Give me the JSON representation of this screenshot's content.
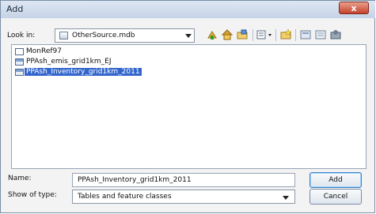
{
  "window": {
    "title": "Add",
    "close_glyph": "x"
  },
  "look_in": {
    "label": "Look in:",
    "value": "OtherSource.mdb",
    "icon": "database-icon"
  },
  "toolbar": [
    {
      "name": "go-up-icon"
    },
    {
      "name": "home-icon"
    },
    {
      "name": "connect-folder-icon"
    },
    {
      "name": "view-menu-icon"
    },
    {
      "name": "new-folder-icon"
    },
    {
      "name": "catalog-icon"
    },
    {
      "name": "properties-icon"
    },
    {
      "name": "toolbox-icon"
    }
  ],
  "files": [
    {
      "label": "MonRef97",
      "icon": "feature-dataset-icon",
      "selected": false
    },
    {
      "label": "PPAsh_emis_grid1km_EJ",
      "icon": "table-icon",
      "selected": false
    },
    {
      "label": "PPAsh_Inventory_grid1km_2011",
      "icon": "table-icon",
      "selected": true
    }
  ],
  "name_field": {
    "label": "Name:",
    "value": "PPAsh_Inventory_grid1km_2011"
  },
  "show_type": {
    "label": "Show of type:",
    "value": "Tables and feature classes"
  },
  "buttons": {
    "add": "Add",
    "cancel": "Cancel"
  }
}
